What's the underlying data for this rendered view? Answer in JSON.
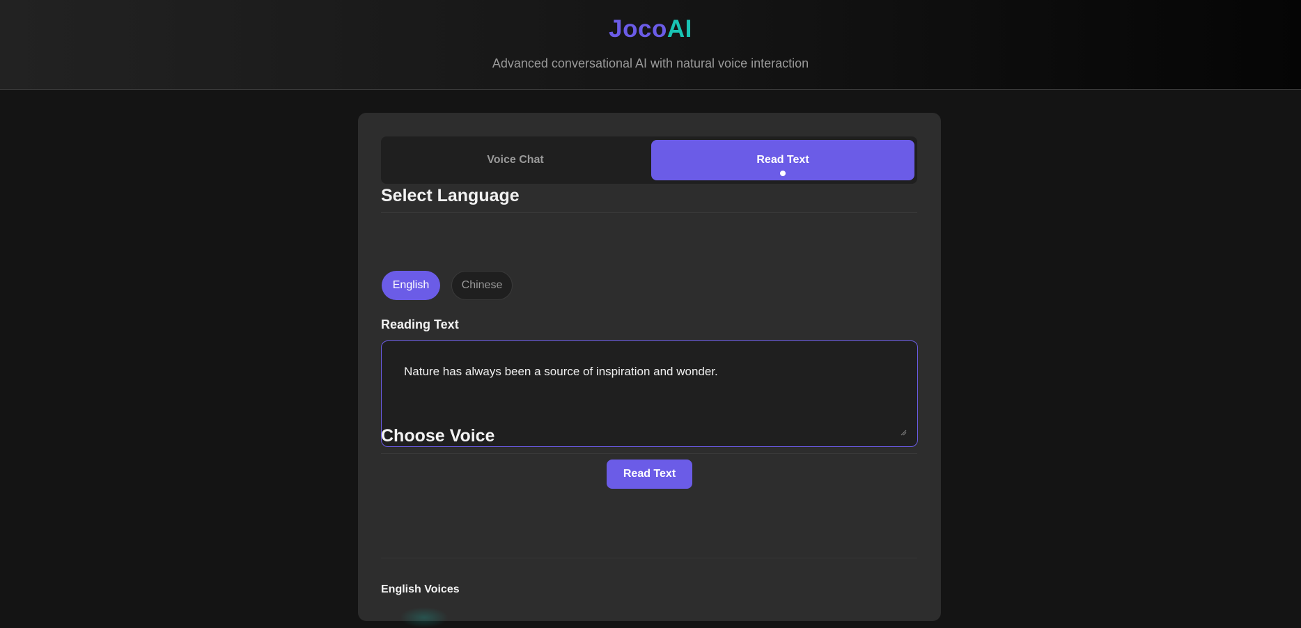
{
  "header": {
    "logo_part1": "Joco",
    "logo_part2": "AI",
    "tagline": "Advanced conversational AI with natural voice interaction"
  },
  "tabs": [
    {
      "label": "Voice Chat",
      "active": false
    },
    {
      "label": "Read Text",
      "active": true
    }
  ],
  "language_section": {
    "title": "Select Language",
    "options": [
      {
        "label": "English",
        "selected": true
      },
      {
        "label": "Chinese",
        "selected": false
      }
    ]
  },
  "reading": {
    "label": "Reading Text",
    "value": "Nature has always been a source of inspiration and wonder.",
    "button_label": "Read Text"
  },
  "voice_section": {
    "title": "Choose Voice",
    "group_label": "English Voices"
  },
  "colors": {
    "accent": "#6b5ce7",
    "teal": "#19c3b3",
    "background": "#141414",
    "card": "#2d2d2d"
  }
}
